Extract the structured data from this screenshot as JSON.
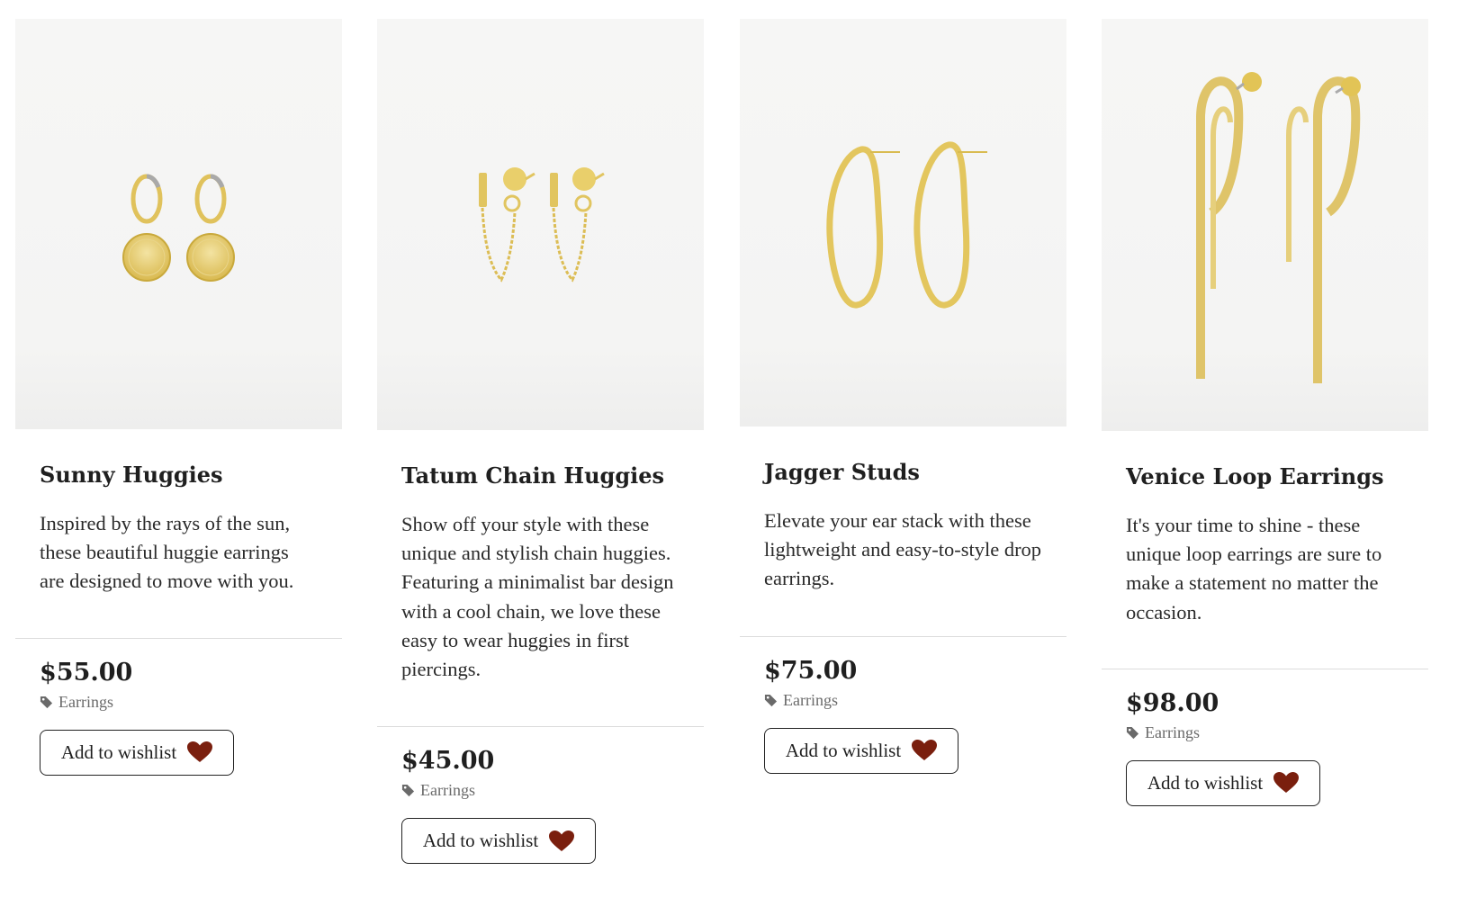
{
  "products": [
    {
      "title": "Sunny Huggies",
      "description": "Inspired by the rays of the sun, these beautiful huggie earrings are designed to move with you.",
      "price": "$55.00",
      "category": "Earrings",
      "wishlist_label": "Add to wishlist",
      "image_icon": "sunny-huggies-image"
    },
    {
      "title": "Tatum Chain Huggies",
      "description": "Show off your style with these unique and stylish chain huggies. Featuring a minimalist bar design with a cool chain, we love these easy to wear huggies in first piercings.",
      "price": "$45.00",
      "category": "Earrings",
      "wishlist_label": "Add to wishlist",
      "image_icon": "tatum-chain-huggies-image"
    },
    {
      "title": "Jagger Studs",
      "description": "Elevate your ear stack with these lightweight and easy-to-style drop earrings.",
      "price": "$75.00",
      "category": "Earrings",
      "wishlist_label": "Add to wishlist",
      "image_icon": "jagger-studs-image"
    },
    {
      "title": "Venice Loop Earrings",
      "description": "It's your time to shine - these unique loop earrings are sure to make a statement no matter the occasion.",
      "price": "$98.00",
      "category": "Earrings",
      "wishlist_label": "Add to wishlist",
      "image_icon": "venice-loop-earrings-image"
    }
  ],
  "colors": {
    "heart": "#7a1f0e",
    "gold": "#e3c96a",
    "tag": "#6a6a6a"
  }
}
